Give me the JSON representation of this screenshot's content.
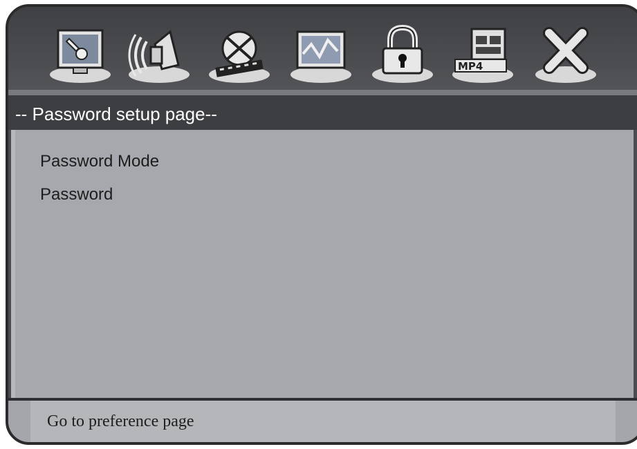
{
  "toolbar": {
    "icons": [
      {
        "name": "general-setup-icon"
      },
      {
        "name": "audio-setup-icon"
      },
      {
        "name": "video-setup-icon"
      },
      {
        "name": "preference-setup-icon"
      },
      {
        "name": "password-lock-icon"
      },
      {
        "name": "mp4-setup-icon"
      },
      {
        "name": "exit-icon"
      }
    ]
  },
  "page": {
    "title": "-- Password setup page--"
  },
  "menu": {
    "items": [
      {
        "label": "Password Mode"
      },
      {
        "label": "Password"
      }
    ]
  },
  "footer": {
    "hint": "Go to preference page"
  },
  "colors": {
    "frame": "#2b2b2b",
    "toolbar": "#4b4c4f",
    "title_bar": "#3d3e42",
    "panel": "#a6a8ad",
    "footer": "#b4b6ba"
  }
}
